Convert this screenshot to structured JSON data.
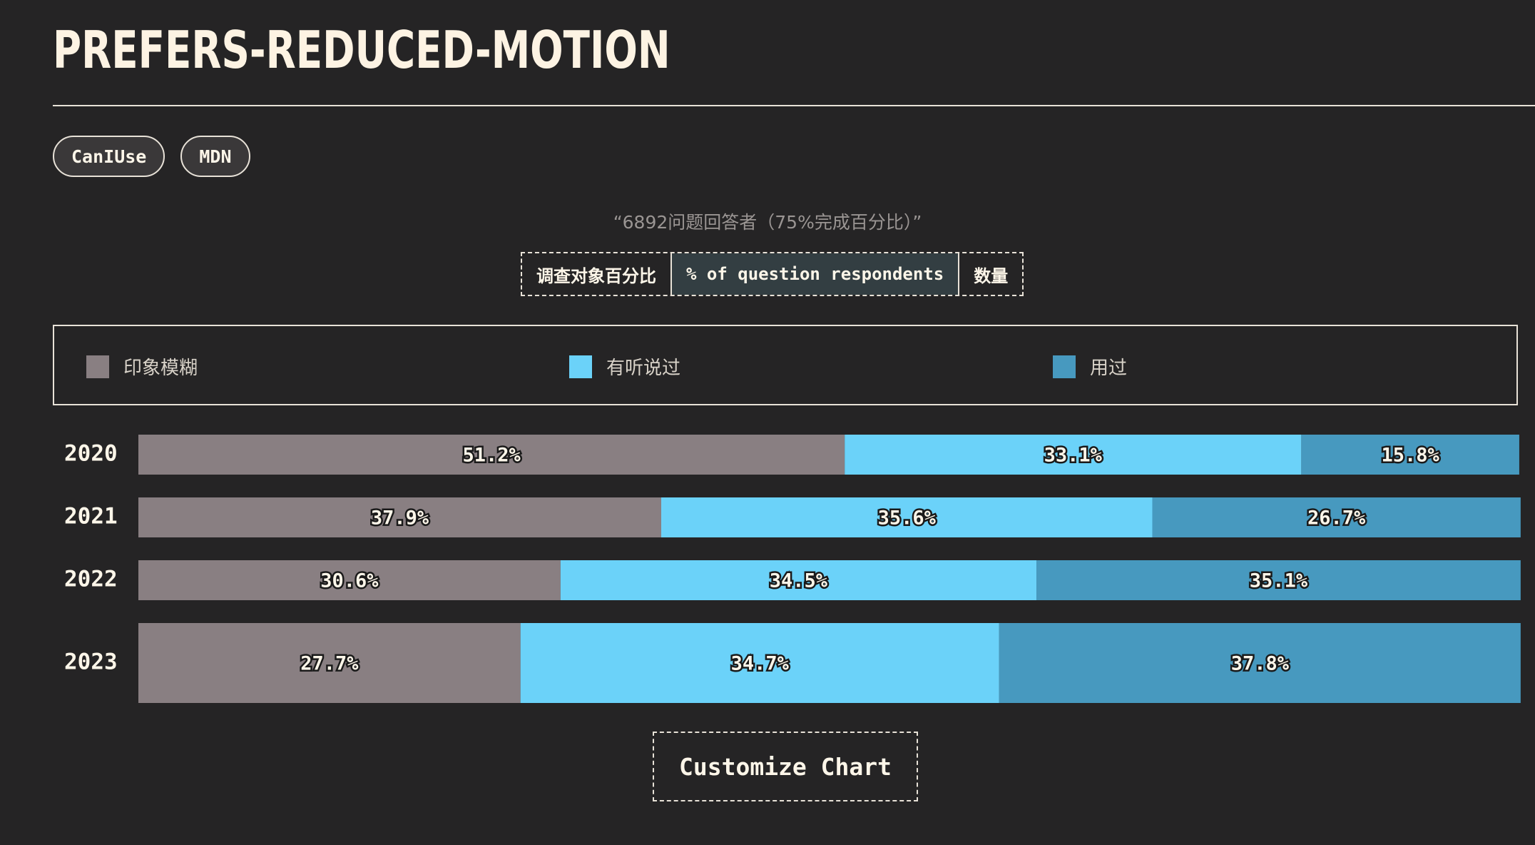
{
  "title": "PREFERS-REDUCED-MOTION",
  "links": [
    {
      "label": "CanIUse"
    },
    {
      "label": "MDN"
    }
  ],
  "subtitle": "“6892问题回答者（75%完成百分比）”",
  "toggle": {
    "options": [
      "调查对象百分比",
      "% of question respondents",
      "数量"
    ],
    "active_index": 1
  },
  "customize_label": "Customize Chart",
  "colors": {
    "vague": "#897f82",
    "heard": "#6bd2f9",
    "used": "#4799bf"
  },
  "chart_data": {
    "type": "bar",
    "orientation": "horizontal",
    "stacked": true,
    "unit": "%",
    "categories": [
      "2020",
      "2021",
      "2022",
      "2023"
    ],
    "series": [
      {
        "name": "印象模糊",
        "values": [
          51.2,
          37.9,
          30.6,
          27.7
        ]
      },
      {
        "name": "有听说过",
        "values": [
          33.1,
          35.6,
          34.5,
          34.7
        ]
      },
      {
        "name": "用过",
        "values": [
          15.8,
          26.7,
          35.1,
          37.8
        ]
      }
    ],
    "legend_position": "top",
    "xlim": [
      0,
      100
    ]
  }
}
